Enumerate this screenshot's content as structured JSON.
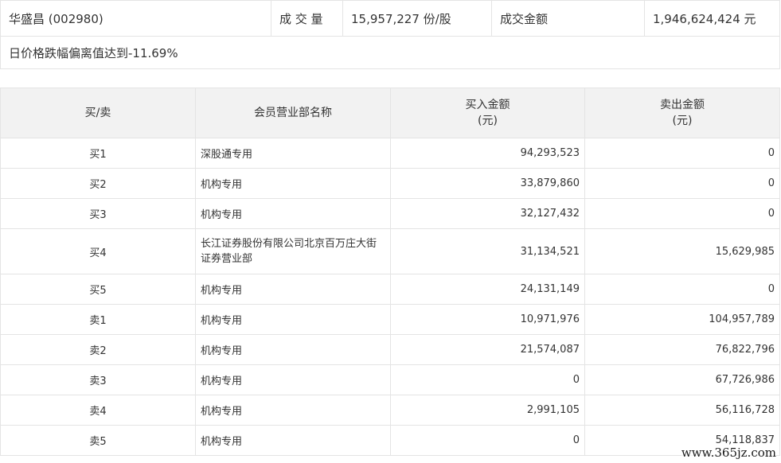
{
  "summary": {
    "stock": "华盛昌 (002980)",
    "volume_label": "成 交 量",
    "volume_value": "15,957,227 份/股",
    "amount_label": "成交金额",
    "amount_value": "1,946,624,424 元",
    "note": "日价格跌幅偏离值达到-11.69%"
  },
  "table": {
    "headers": {
      "side": "买/卖",
      "member": "会员营业部名称",
      "buy": "买入金额",
      "buy_unit": "(元)",
      "sell": "卖出金额",
      "sell_unit": "(元)"
    },
    "rows": [
      {
        "side": "买1",
        "member": "深股通专用",
        "buy": "94,293,523",
        "sell": "0"
      },
      {
        "side": "买2",
        "member": "机构专用",
        "buy": "33,879,860",
        "sell": "0"
      },
      {
        "side": "买3",
        "member": "机构专用",
        "buy": "32,127,432",
        "sell": "0"
      },
      {
        "side": "买4",
        "member": "长江证券股份有限公司北京百万庄大街证券营业部",
        "buy": "31,134,521",
        "sell": "15,629,985"
      },
      {
        "side": "买5",
        "member": "机构专用",
        "buy": "24,131,149",
        "sell": "0"
      },
      {
        "side": "卖1",
        "member": "机构专用",
        "buy": "10,971,976",
        "sell": "104,957,789"
      },
      {
        "side": "卖2",
        "member": "机构专用",
        "buy": "21,574,087",
        "sell": "76,822,796"
      },
      {
        "side": "卖3",
        "member": "机构专用",
        "buy": "0",
        "sell": "67,726,986"
      },
      {
        "side": "卖4",
        "member": "机构专用",
        "buy": "2,991,105",
        "sell": "56,116,728"
      },
      {
        "side": "卖5",
        "member": "机构专用",
        "buy": "0",
        "sell": "54,118,837"
      }
    ]
  },
  "watermark": "www.365jz.com"
}
